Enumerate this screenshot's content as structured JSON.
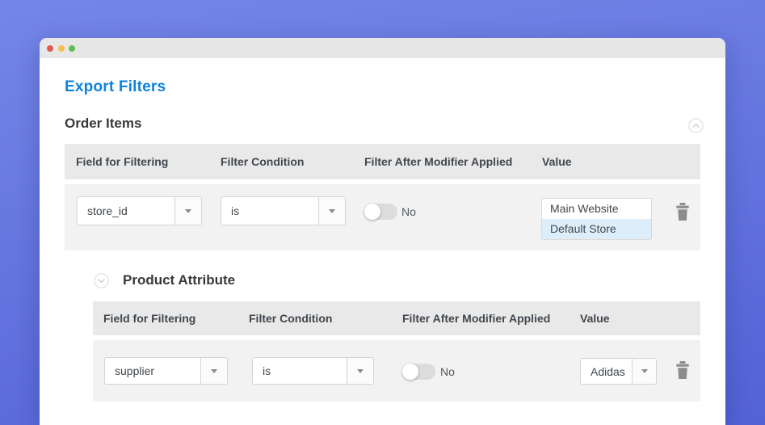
{
  "titlebar": {
    "dot_colors": [
      "#e25a4d",
      "#f1c04f",
      "#5dbf55"
    ]
  },
  "page": {
    "title": "Export Filters"
  },
  "sections": [
    {
      "title": "Order Items",
      "collapse_icon": "chevron-up-circle",
      "columns": [
        "Field for Filtering",
        "Filter Condition",
        "Filter After Modifier Applied",
        "Value"
      ],
      "row": {
        "field": "store_id",
        "condition": "is",
        "modifier_toggle_state": "off",
        "modifier_label": "No",
        "value_options": [
          "Main Website",
          "Default Store"
        ],
        "value_selected": "Default Store"
      }
    },
    {
      "title": "Product Attribute",
      "expand_icon": "chevron-down-circle",
      "columns": [
        "Field for Filtering",
        "Filter Condition",
        "Filter After Modifier Applied",
        "Value"
      ],
      "row": {
        "field": "supplier",
        "condition": "is",
        "modifier_toggle_state": "off",
        "modifier_label": "No",
        "value": "Adidas"
      }
    }
  ],
  "colors": {
    "accent_blue": "#0d83dd",
    "header_bg": "#e9e9e9",
    "row_bg": "#f2f2f2",
    "selected_option_bg": "#ddeefa",
    "background_gradient_top": "#7486e7",
    "background_gradient_bottom": "#5362d5"
  }
}
